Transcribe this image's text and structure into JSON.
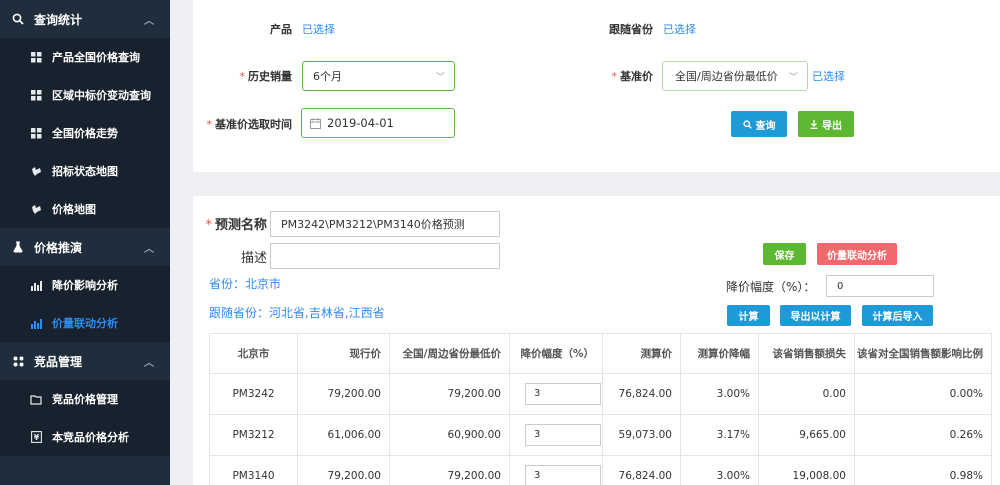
{
  "sidebar": {
    "groups": [
      {
        "label": "查询统计",
        "icon": "search-icon",
        "items": [
          {
            "label": "产品全国价格查询",
            "icon": "grid-icon"
          },
          {
            "label": "区域中标价变动查询",
            "icon": "grid-icon"
          },
          {
            "label": "全国价格走势",
            "icon": "grid-icon"
          },
          {
            "label": "招标状态地图",
            "icon": "map-icon"
          },
          {
            "label": "价格地图",
            "icon": "map-icon"
          }
        ]
      },
      {
        "label": "价格推演",
        "icon": "flask-icon",
        "items": [
          {
            "label": "降价影响分析",
            "icon": "chart-icon"
          },
          {
            "label": "价量联动分析",
            "icon": "chart-icon",
            "active": true
          }
        ]
      },
      {
        "label": "竞品管理",
        "icon": "apps-icon",
        "items": [
          {
            "label": "竞品价格管理",
            "icon": "folder-icon"
          },
          {
            "label": "本竞品价格分析",
            "icon": "yen-icon"
          }
        ]
      }
    ]
  },
  "filters": {
    "product_label": "产品",
    "product_link": "已选择",
    "follow_province_label": "跟随省份",
    "follow_province_link": "已选择",
    "history_sales_label": "历史销量",
    "history_sales_value": "6个月",
    "base_price_label": "基准价",
    "base_price_value": "全国/周边省份最低价",
    "base_price_link": "已选择",
    "base_time_label": "基准价选取时间",
    "base_time_value": "2019-04-01",
    "query_button": "查询",
    "export_button": "导出"
  },
  "forecast": {
    "name_label": "预测名称",
    "name_value": "PM3242\\PM3212\\PM3140价格预测",
    "desc_label": "描述",
    "desc_value": "",
    "province_text": "省份：北京市",
    "follow_text": "跟随省份：河北省,吉林省,江西省",
    "save_button": "保存",
    "linkage_button": "价量联动分析",
    "discount_label": "降价幅度（%）：",
    "discount_value": "0",
    "calc_button": "计算",
    "export_calc_button": "导出以计算",
    "calc_import_button": "计算后导入"
  },
  "table": {
    "headers": [
      "北京市",
      "现行价",
      "全国/周边省份最低价",
      "降价幅度（%）",
      "测算价",
      "测算价降幅",
      "该省销售额损失",
      "该省对全国销售额影响比例"
    ],
    "rows": [
      [
        "PM3242",
        "79,200.00",
        "79,200.00",
        "3",
        "76,824.00",
        "3.00%",
        "0.00",
        "0.00%"
      ],
      [
        "PM3212",
        "61,006.00",
        "60,900.00",
        "3",
        "59,073.00",
        "3.17%",
        "9,665.00",
        "0.26%"
      ],
      [
        "PM3140",
        "79,200.00",
        "79,200.00",
        "3",
        "76,824.00",
        "3.00%",
        "19,008.00",
        "0.98%"
      ]
    ]
  },
  "colors": {
    "sidebar_bg": "#1f2d3d",
    "accent_blue": "#2d8cf0",
    "button_blue": "#1e9ad7",
    "button_green": "#5cb831",
    "button_red": "#f0696d",
    "required": "#e45540"
  }
}
